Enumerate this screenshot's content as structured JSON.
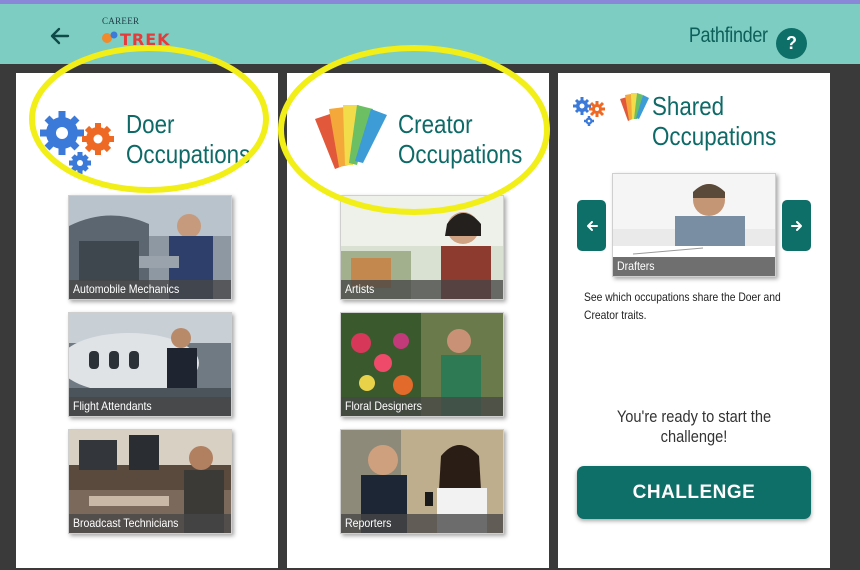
{
  "header": {
    "logo_small": "CAREER",
    "logo_big": "TREK",
    "title": "Pathfinder",
    "help_label": "?"
  },
  "icons": {
    "back": "arrow-left-icon",
    "help": "question-mark-icon",
    "doer": "gears-icon",
    "creator": "color-swatches-icon",
    "prev": "arrow-left-icon",
    "next": "arrow-right-icon"
  },
  "doer": {
    "title_line1": "Doer",
    "title_line2": "Occupations",
    "cards": [
      {
        "label": "Automobile Mechanics"
      },
      {
        "label": "Flight Attendants"
      },
      {
        "label": "Broadcast Technicians"
      }
    ]
  },
  "creator": {
    "title_line1": "Creator",
    "title_line2": "Occupations",
    "cards": [
      {
        "label": "Artists"
      },
      {
        "label": "Floral Designers"
      },
      {
        "label": "Reporters"
      }
    ]
  },
  "shared": {
    "title_line1": "Shared",
    "title_line2": "Occupations",
    "carousel_label": "Drafters",
    "description": "See which occupations share the Doer and Creator traits.",
    "ready_text": "You're ready to start the challenge!",
    "challenge_label": "CHALLENGE"
  },
  "colors": {
    "header_bg": "#7ecdc2",
    "accent": "#0e6e68",
    "title_text": "#0e6a67",
    "highlight": "#f2ee18",
    "background": "#3a3a3a"
  }
}
